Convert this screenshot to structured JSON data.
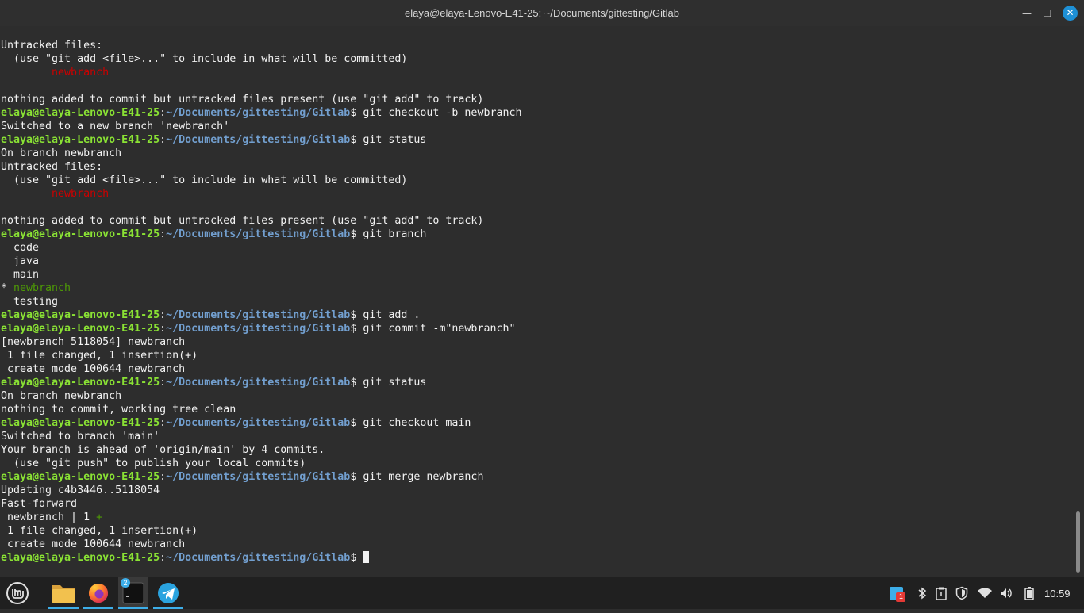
{
  "window": {
    "title": "elaya@elaya-Lenovo-E41-25: ~/Documents/gittesting/Gitlab",
    "minimize_icon": "minimize-icon",
    "maximize_icon": "restore-icon",
    "close_icon": "close-icon"
  },
  "prompt": {
    "user_host": "elaya@elaya-Lenovo-E41-25",
    "colon": ":",
    "path": "~/Documents/gittesting/Gitlab",
    "dollar": "$ "
  },
  "terminal": {
    "lines": [
      {
        "type": "text",
        "text": "Untracked files:"
      },
      {
        "type": "text",
        "text": "  (use \"git add <file>...\" to include in what will be committed)"
      },
      {
        "type": "red",
        "text": "        newbranch"
      },
      {
        "type": "text",
        "text": ""
      },
      {
        "type": "text",
        "text": "nothing added to commit but untracked files present (use \"git add\" to track)"
      },
      {
        "type": "prompt",
        "cmd": "git checkout -b newbranch"
      },
      {
        "type": "text",
        "text": "Switched to a new branch 'newbranch'"
      },
      {
        "type": "prompt",
        "cmd": "git status"
      },
      {
        "type": "text",
        "text": "On branch newbranch"
      },
      {
        "type": "text",
        "text": "Untracked files:"
      },
      {
        "type": "text",
        "text": "  (use \"git add <file>...\" to include in what will be committed)"
      },
      {
        "type": "red",
        "text": "        newbranch"
      },
      {
        "type": "text",
        "text": ""
      },
      {
        "type": "text",
        "text": "nothing added to commit but untracked files present (use \"git add\" to track)"
      },
      {
        "type": "prompt",
        "cmd": "git branch"
      },
      {
        "type": "text",
        "text": "  code"
      },
      {
        "type": "text",
        "text": "  java"
      },
      {
        "type": "text",
        "text": "  main"
      },
      {
        "type": "branch",
        "prefix": "* ",
        "text": "newbranch"
      },
      {
        "type": "text",
        "text": "  testing"
      },
      {
        "type": "prompt",
        "cmd": "git add ."
      },
      {
        "type": "prompt",
        "cmd": "git commit -m\"newbranch\""
      },
      {
        "type": "text",
        "text": "[newbranch 5118054] newbranch"
      },
      {
        "type": "text",
        "text": " 1 file changed, 1 insertion(+)"
      },
      {
        "type": "text",
        "text": " create mode 100644 newbranch"
      },
      {
        "type": "prompt",
        "cmd": "git status"
      },
      {
        "type": "text",
        "text": "On branch newbranch"
      },
      {
        "type": "text",
        "text": "nothing to commit, working tree clean"
      },
      {
        "type": "prompt",
        "cmd": "git checkout main"
      },
      {
        "type": "text",
        "text": "Switched to branch 'main'"
      },
      {
        "type": "text",
        "text": "Your branch is ahead of 'origin/main' by 4 commits."
      },
      {
        "type": "text",
        "text": "  (use \"git push\" to publish your local commits)"
      },
      {
        "type": "prompt",
        "cmd": "git merge newbranch"
      },
      {
        "type": "text",
        "text": "Updating c4b3446..5118054"
      },
      {
        "type": "text",
        "text": "Fast-forward"
      },
      {
        "type": "diffstat",
        "text": " newbranch | 1 ",
        "plus": "+"
      },
      {
        "type": "text",
        "text": " 1 file changed, 1 insertion(+)"
      },
      {
        "type": "text",
        "text": " create mode 100644 newbranch"
      },
      {
        "type": "prompt",
        "cmd": "",
        "cursor": true
      }
    ]
  },
  "taskbar": {
    "menu_icon": "linux-mint-menu-icon",
    "apps": [
      {
        "name": "files-app",
        "icon": "folder-icon"
      },
      {
        "name": "firefox-app",
        "icon": "firefox-icon"
      },
      {
        "name": "terminal-app",
        "icon": "terminal-icon",
        "badge": "2"
      },
      {
        "name": "telegram-app",
        "icon": "telegram-icon"
      }
    ],
    "tray": {
      "update_badge": "1",
      "icons": [
        "update-manager-icon",
        "bluetooth-icon",
        "clipboard-icon",
        "shield-icon",
        "wifi-icon",
        "volume-icon",
        "battery-icon"
      ]
    },
    "clock": "10:59"
  },
  "colors": {
    "background": "#2d2d2d",
    "prompt_user": "#8ae234",
    "prompt_path": "#729fcf",
    "untracked_red": "#cc0000",
    "branch_green": "#4e9a06",
    "accent": "#3daee9"
  }
}
